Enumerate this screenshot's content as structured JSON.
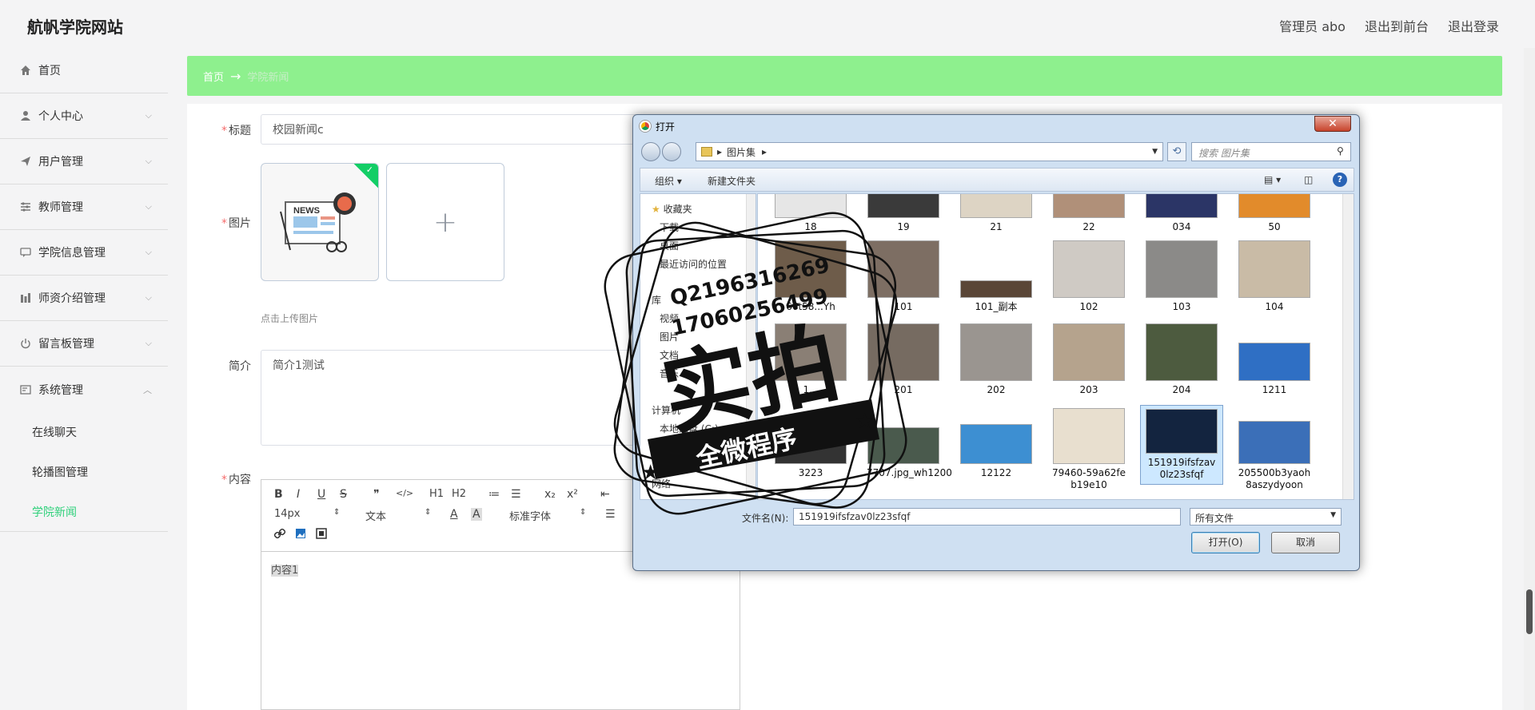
{
  "header": {
    "site_title": "航帆学院网站",
    "links": [
      "管理员 abo",
      "退出到前台",
      "退出登录"
    ]
  },
  "sidebar": {
    "items": [
      {
        "label": "首页",
        "icon": "home-icon"
      },
      {
        "label": "个人中心",
        "icon": "user-icon"
      },
      {
        "label": "用户管理",
        "icon": "send-icon"
      },
      {
        "label": "教师管理",
        "icon": "sliders-icon"
      },
      {
        "label": "学院信息管理",
        "icon": "chat-icon"
      },
      {
        "label": "师资介绍管理",
        "icon": "bar-chart-icon"
      },
      {
        "label": "留言板管理",
        "icon": "power-icon"
      },
      {
        "label": "系统管理",
        "icon": "system-icon"
      }
    ],
    "sub_items": [
      "在线聊天",
      "轮播图管理",
      "学院新闻"
    ],
    "active_sub": "学院新闻"
  },
  "breadcrumb": {
    "home": "首页",
    "arrow": "→",
    "current": "学院新闻"
  },
  "form": {
    "title_label": "标题",
    "title_value": "校园新闻c",
    "image_label": "图片",
    "upload_hint": "点击上传图片",
    "intro_label": "简介",
    "intro_value": "简介1测试",
    "content_label": "内容",
    "content_value": "内容1",
    "news_thumb_text": "NEWS",
    "toolbar": {
      "font_size": "14px",
      "text_type": "文本",
      "font_family": "标准字体",
      "buttons": [
        "B",
        "I",
        "U",
        "S",
        "❞",
        "</>",
        "H1",
        "H2",
        "≔",
        "☰",
        "x₂",
        "x²",
        "⇤"
      ]
    }
  },
  "dialog": {
    "title": "打开",
    "close": "✕",
    "address": "图片集",
    "search_placeholder": "搜索 图片集",
    "organize": "组织 ▾",
    "new_folder": "新建文件夹",
    "nav": [
      "收藏夹",
      "下载",
      "桌面",
      "最近访问的位置",
      "库",
      "视频",
      "图片",
      "文档",
      "音乐",
      "计算机",
      "本地磁盘 (C:)",
      "软件 (D:)",
      "网络"
    ],
    "files": [
      "18",
      "19",
      "21",
      "22",
      "034",
      "50",
      "66t58...Yh",
      "101",
      "101_副本",
      "102",
      "103",
      "104",
      "1...",
      "201",
      "202",
      "203",
      "204",
      "1211",
      "3223",
      "7707.jpg_wh1200",
      "12122",
      "79460-59a62feb19e10",
      "151919ifsfzav0lz23sfqf",
      "205500b3yaoh8aszydyoon"
    ],
    "selected_file": "151919ifsfzav0lz23sfqf",
    "filename_label": "文件名(N):",
    "filename_value": "151919ifsfzav0lz23sfqf",
    "filetype": "所有文件",
    "open_button": "打开(O)",
    "cancel_button": "取消"
  },
  "watermark": {
    "qq1": "Q2196316269",
    "qq2": "17060256499",
    "main": "实拍",
    "sub": "全微程序"
  },
  "colors": {
    "accent": "#8ef08e",
    "active": "#2ed07a",
    "check": "#13ce66"
  }
}
